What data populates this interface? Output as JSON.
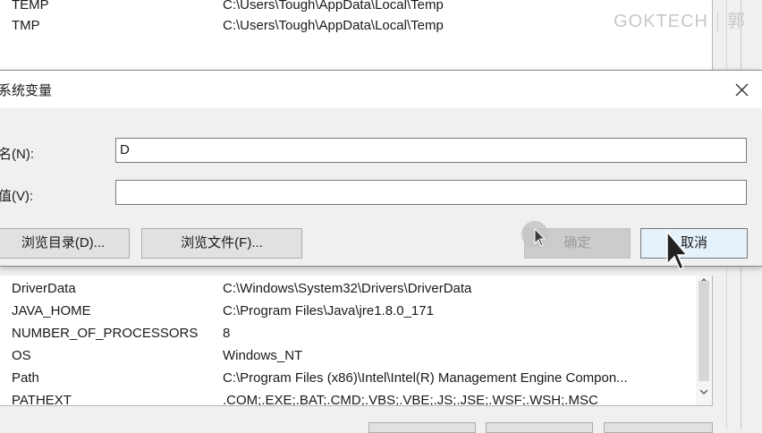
{
  "watermark": {
    "brand": "GOKTECH",
    "char": "郭"
  },
  "top_vars": [
    {
      "name": "TEMP",
      "value": "C:\\Users\\Tough\\AppData\\Local\\Temp"
    },
    {
      "name": "TMP",
      "value": "C:\\Users\\Tough\\AppData\\Local\\Temp"
    }
  ],
  "dialog": {
    "title": "系统变量",
    "name_label": "名(N):",
    "value_label": "值(V):",
    "name_value": "D",
    "value_value": "",
    "browse_dir": "浏览目录(D)...",
    "browse_file": "浏览文件(F)...",
    "ok": "确定",
    "cancel": "取消"
  },
  "bottom_vars": [
    {
      "name": "DriverData",
      "value": "C:\\Windows\\System32\\Drivers\\DriverData"
    },
    {
      "name": "JAVA_HOME",
      "value": "C:\\Program Files\\Java\\jre1.8.0_171"
    },
    {
      "name": "NUMBER_OF_PROCESSORS",
      "value": "8"
    },
    {
      "name": "OS",
      "value": "Windows_NT"
    },
    {
      "name": "Path",
      "value": "C:\\Program Files (x86)\\Intel\\Intel(R) Management Engine Compon..."
    },
    {
      "name": "PATHEXT",
      "value": ".COM;.EXE;.BAT;.CMD;.VBS;.VBE;.JS;.JSE;.WSF;.WSH;.MSC"
    }
  ]
}
